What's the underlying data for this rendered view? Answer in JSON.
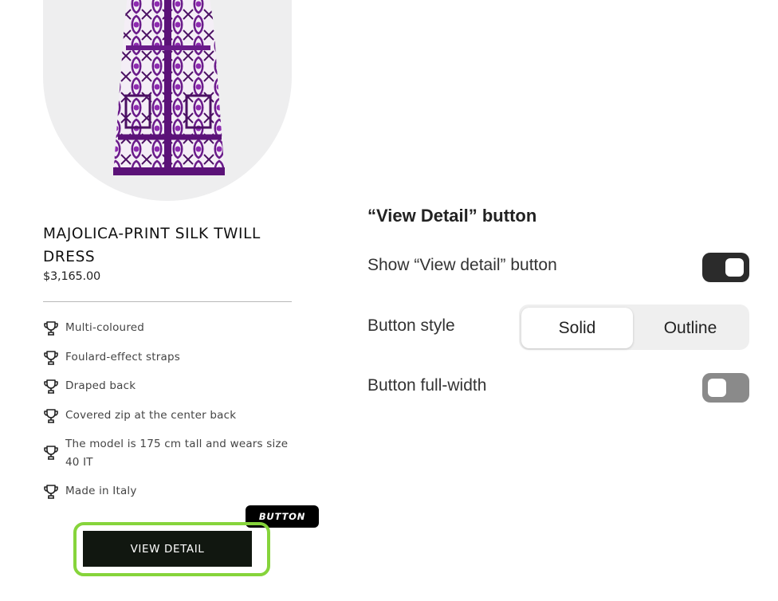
{
  "product": {
    "title": "MAJOLICA-PRINT SILK TWILL DRESS",
    "price": "$3,165.00",
    "image_icon": "dress-image",
    "features": [
      {
        "text": "Multi-coloured",
        "icon": "trophy-icon"
      },
      {
        "text": "Foulard-effect straps",
        "icon": "trophy-icon"
      },
      {
        "text": "Draped back",
        "icon": "trophy-icon"
      },
      {
        "text": "Covered zip at the center back",
        "icon": "trophy-icon"
      },
      {
        "text": "The model is 175 cm tall and wears size 40 IT",
        "icon": "trophy-icon"
      },
      {
        "text": "Made in Italy",
        "icon": "trophy-icon"
      }
    ],
    "button_label": "VIEW DETAIL",
    "button_tag": "BUTTON"
  },
  "settings": {
    "title": "“View Detail” button",
    "show_button": {
      "label": "Show “View detail” button",
      "enabled": true
    },
    "button_style": {
      "label": "Button style",
      "options": [
        "Solid",
        "Outline"
      ],
      "selected": "Solid"
    },
    "full_width": {
      "label": "Button full-width",
      "enabled": false
    }
  },
  "colors": {
    "highlight": "#86d43b",
    "button_bg": "#111710",
    "toggle_on": "#2b2b2b",
    "toggle_off": "#8a8a8a",
    "dress_purple": "#6a1b8a"
  }
}
